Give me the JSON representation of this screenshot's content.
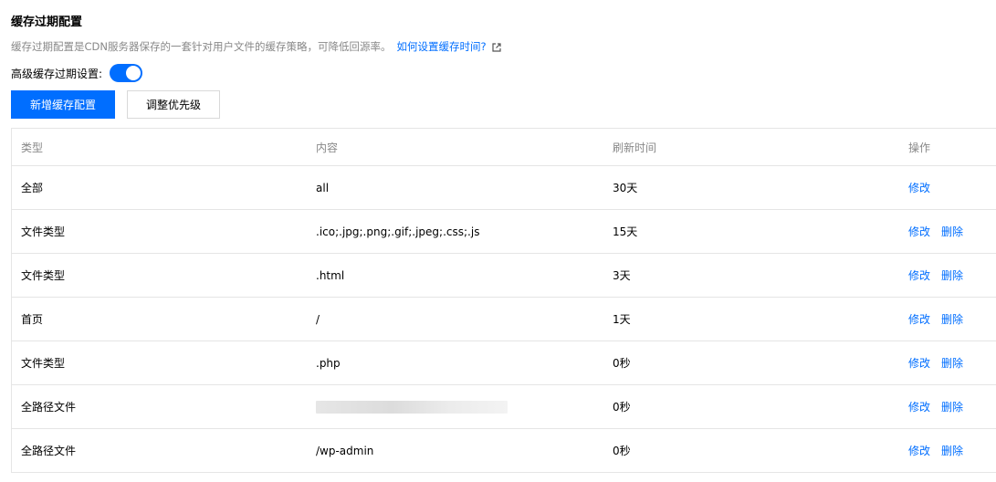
{
  "header": {
    "title": "缓存过期配置",
    "description": "缓存过期配置是CDN服务器保存的一套针对用户文件的缓存策略，可降低回源率。",
    "help_link": "如何设置缓存时间?"
  },
  "toggle": {
    "label": "高级缓存过期设置:",
    "state": "on"
  },
  "buttons": {
    "add": "新增缓存配置",
    "priority": "调整优先级"
  },
  "table": {
    "columns": [
      "类型",
      "内容",
      "刷新时间",
      "操作"
    ],
    "rows": [
      {
        "type": "全部",
        "content": "all",
        "ttl": "30天",
        "edit": "修改",
        "delete": ""
      },
      {
        "type": "文件类型",
        "content": ".ico;.jpg;.png;.gif;.jpeg;.css;.js",
        "ttl": "15天",
        "edit": "修改",
        "delete": "删除"
      },
      {
        "type": "文件类型",
        "content": ".html",
        "ttl": "3天",
        "edit": "修改",
        "delete": "删除"
      },
      {
        "type": "首页",
        "content": "/",
        "ttl": "1天",
        "edit": "修改",
        "delete": "删除"
      },
      {
        "type": "文件类型",
        "content": ".php",
        "ttl": "0秒",
        "edit": "修改",
        "delete": "删除"
      },
      {
        "type": "全路径文件",
        "content": "",
        "ttl": "0秒",
        "edit": "修改",
        "delete": "删除"
      },
      {
        "type": "全路径文件",
        "content": "/wp-admin",
        "ttl": "0秒",
        "edit": "修改",
        "delete": "删除"
      }
    ]
  },
  "colors": {
    "accent": "#006eff",
    "muted_text": "#888888",
    "border": "#e5e5e5"
  },
  "icons": {
    "external_link": "external-link-icon"
  }
}
